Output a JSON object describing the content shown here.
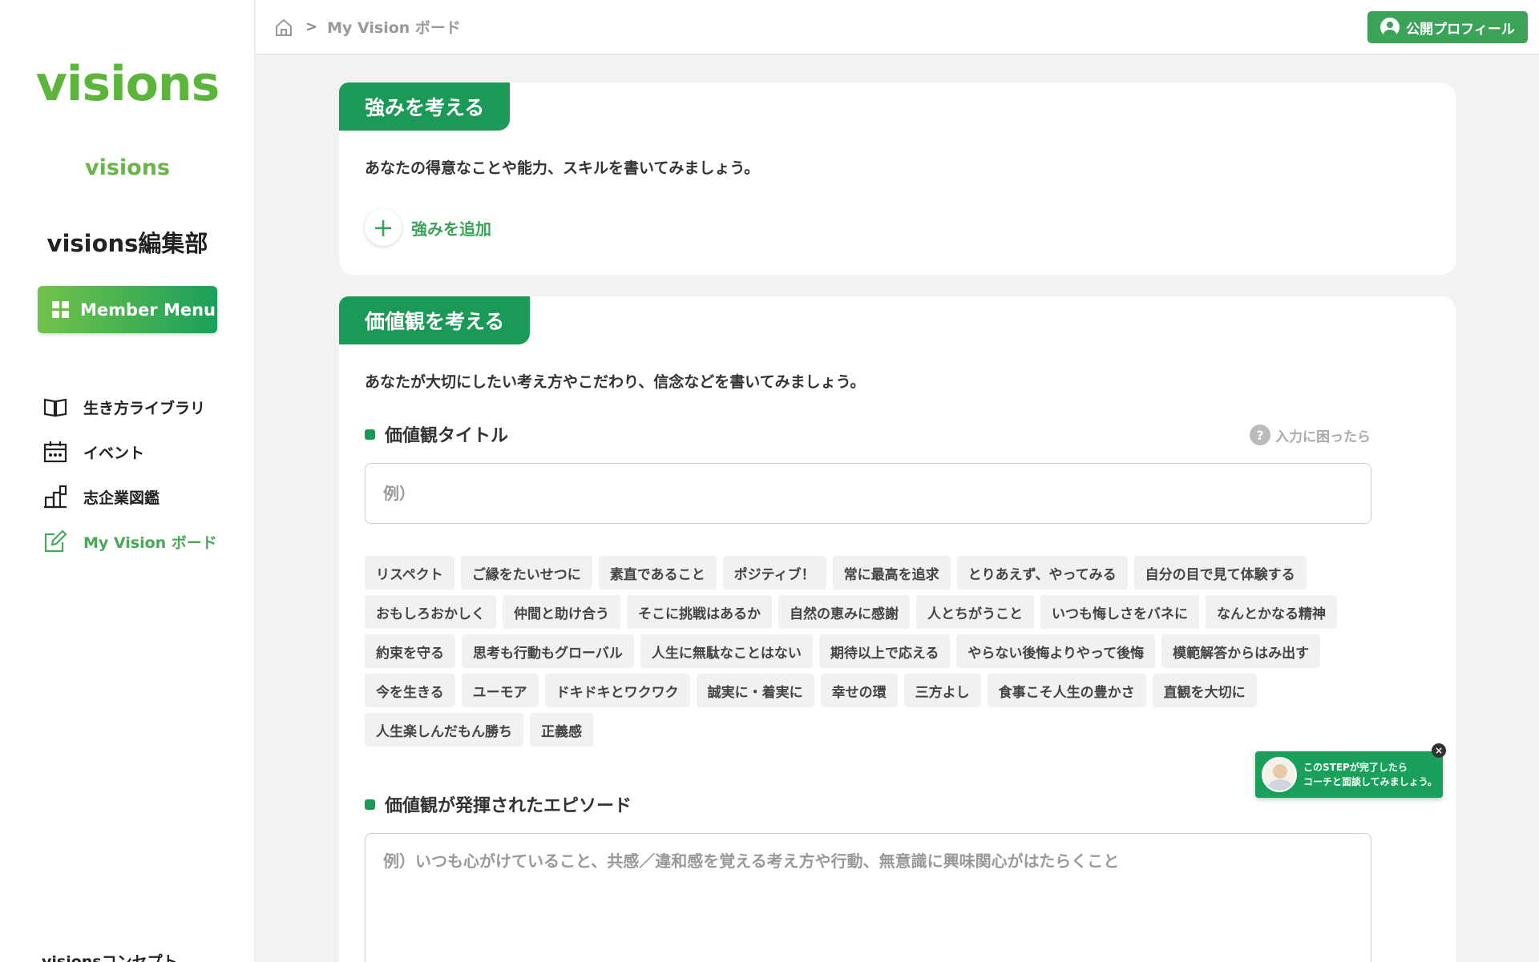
{
  "sidebar": {
    "logo": "visions",
    "sub_logo": "visions",
    "org_name": "visions編集部",
    "member_menu_label": "Member Menu",
    "items": [
      {
        "label": "生き方ライブラリ",
        "icon": "book-icon"
      },
      {
        "label": "イベント",
        "icon": "calendar-icon"
      },
      {
        "label": "志企業図鑑",
        "icon": "building-icon"
      },
      {
        "label": "My Vision ボード",
        "icon": "edit-icon",
        "active": true
      }
    ],
    "bottom_item_label": "visionsコンセプト"
  },
  "header": {
    "breadcrumb_current": "My Vision ボード",
    "profile_button_label": "公開プロフィール"
  },
  "strengths": {
    "tab_title": "強みを考える",
    "description": "あなたの得意なことや能力、スキルを書いてみましょう。",
    "add_label": "強みを追加"
  },
  "values": {
    "tab_title": "価値観を考える",
    "description": "あなたが大切にしたい考え方やこだわり、信念などを書いてみましょう。",
    "title_label": "価値観タイトル",
    "help_label": "入力に困ったら",
    "title_placeholder": "例）",
    "chips": [
      "リスペクト",
      "ご縁をたいせつに",
      "素直であること",
      "ポジティブ！",
      "常に最高を追求",
      "とりあえず、やってみる",
      "自分の目で見て体験する",
      "おもしろおかしく",
      "仲間と助け合う",
      "そこに挑戦はあるか",
      "自然の恵みに感謝",
      "人とちがうこと",
      "いつも悔しさをバネに",
      "なんとかなる精神",
      "約束を守る",
      "思考も行動もグローバル",
      "人生に無駄なことはない",
      "期待以上で応える",
      "やらない後悔よりやって後悔",
      "模範解答からはみ出す",
      "今を生きる",
      "ユーモア",
      "ドキドキとワクワク",
      "誠実に・着実に",
      "幸せの環",
      "三方よし",
      "食事こそ人生の豊かさ",
      "直観を大切に",
      "人生楽しんだもん勝ち",
      "正義感"
    ],
    "episode_label": "価値観が発揮されたエピソード",
    "episode_placeholder": "例）いつも心がけていること、共感／違和感を覚える考え方や行動、無意識に興味関心がはたらくこと"
  },
  "coach_popup": {
    "line1": "このSTEPが完了したら",
    "line2": "コーチと面談してみましょう。"
  },
  "colors": {
    "brand_green": "#1a9a56",
    "logo_green": "#5cb43a",
    "background": "#f2f2f2"
  }
}
